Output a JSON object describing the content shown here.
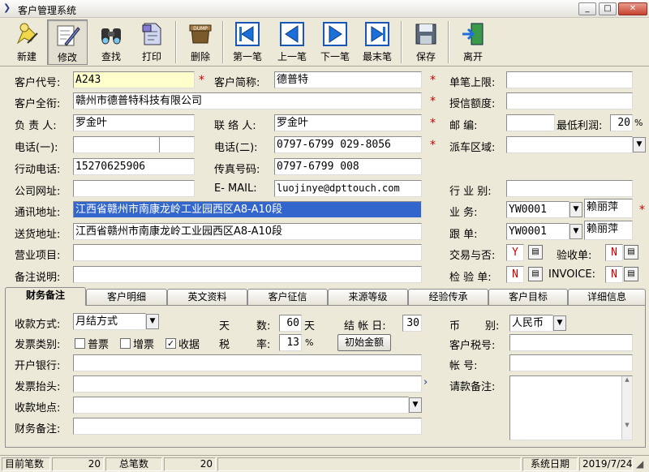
{
  "window": {
    "title": "客户管理系统",
    "min": "_",
    "max": "□",
    "close": "✕"
  },
  "toolbar": [
    {
      "label": "新建",
      "icon": "new-icon"
    },
    {
      "label": "修改",
      "icon": "edit-icon"
    },
    {
      "label": "查找",
      "icon": "find-icon"
    },
    {
      "label": "打印",
      "icon": "print-icon"
    },
    {
      "label": "删除",
      "icon": "delete-icon"
    },
    {
      "label": "第一笔",
      "icon": "first-record-icon"
    },
    {
      "label": "上一笔",
      "icon": "previous-record-icon"
    },
    {
      "label": "下一笔",
      "icon": "next-record-icon"
    },
    {
      "label": "最末笔",
      "icon": "last-record-icon"
    },
    {
      "label": "保存",
      "icon": "save-icon"
    },
    {
      "label": "离开",
      "icon": "exit-icon"
    }
  ],
  "delete_icon_text": "DUMP",
  "form": {
    "customer_code": {
      "label": "客户代号:",
      "value": "A243"
    },
    "short_name": {
      "label": "客户简称:",
      "value": "德普特"
    },
    "single_limit": {
      "label": "单笔上限:",
      "value": ""
    },
    "full_name": {
      "label": "客户全衔:",
      "value": "赣州市德普特科技有限公司"
    },
    "credit_limit": {
      "label": "授信额度:",
      "value": ""
    },
    "owner": {
      "label": "负 责 人:",
      "value": "罗金叶"
    },
    "contact": {
      "label": "联 络 人:",
      "value": "罗金叶"
    },
    "postcode": {
      "label": "邮    编:",
      "value": ""
    },
    "min_profit": {
      "label": "最低利润:",
      "value": "20",
      "unit": "%"
    },
    "phone1": {
      "label": "电话(一):",
      "value": ""
    },
    "phone2": {
      "label": "电话(二):",
      "value": "0797-6799 029-8056"
    },
    "delivery_area": {
      "label": "派车区域:",
      "value": ""
    },
    "mobile": {
      "label": "行动电话:",
      "value": "15270625906"
    },
    "fax": {
      "label": "传真号码:",
      "value": "0797-6799 008"
    },
    "website": {
      "label": "公司网址:",
      "value": ""
    },
    "email": {
      "label": "E- MAIL:",
      "value": "luojinye@dpttouch.com"
    },
    "industry": {
      "label": "行 业 别:",
      "value": ""
    },
    "mail_address": {
      "label": "通讯地址:",
      "value": "江西省赣州市南康龙岭工业园西区A8-A10段"
    },
    "salesman": {
      "label": "业    务:",
      "code": "YW0001",
      "name": "赖丽萍"
    },
    "ship_address": {
      "label": "送货地址:",
      "value": "江西省赣州市南康龙岭工业园西区A8-A10段"
    },
    "follow": {
      "label": "跟    单:",
      "code": "YW0001",
      "name": "赖丽萍"
    },
    "business": {
      "label": "营业项目:",
      "value": ""
    },
    "trade": {
      "label": "交易与否:",
      "value": "Y"
    },
    "acceptance": {
      "label": "验收单:",
      "value": "N"
    },
    "remark": {
      "label": "备注说明:",
      "value": ""
    },
    "inspection": {
      "label": "检 验 单:",
      "value": "N"
    },
    "invoice": {
      "label": "INVOICE:",
      "value": "N"
    }
  },
  "tabs": [
    "财务备注",
    "客户明细",
    "英文资料",
    "客户征信",
    "来源等级",
    "经验传承",
    "客户目标",
    "详细信息"
  ],
  "finance": {
    "pay_method": {
      "label": "收款方式:",
      "value": "月结方式"
    },
    "days": {
      "label_a": "天",
      "label_b": "数:",
      "value": "60",
      "unit": "天"
    },
    "closing_day": {
      "label": "结 帐 日:",
      "value": "30"
    },
    "currency": {
      "label_a": "币",
      "label_b": "别:",
      "value": "人民币"
    },
    "invoice_type": {
      "label": "发票类别:",
      "opt1": "普票",
      "opt2": "增票",
      "opt3": "收据",
      "check": "✓"
    },
    "tax": {
      "label_a": "税",
      "label_b": "率:",
      "value": "13",
      "unit": "%"
    },
    "init_amount": "初始金额",
    "tax_no": {
      "label": "客户税号:",
      "value": ""
    },
    "bank": {
      "label": "开户银行:",
      "value": ""
    },
    "account": {
      "label": "帐    号:",
      "value": ""
    },
    "invoice_title": {
      "label": "发票抬头:",
      "value": ""
    },
    "payment_note": {
      "label": "请款备注:",
      "value": ""
    },
    "collect_place": {
      "label": "收款地点:",
      "value": ""
    },
    "finance_note": {
      "label": "财务备注:",
      "value": ""
    }
  },
  "status": {
    "current_label": "目前笔数",
    "current_value": "20",
    "total_label": "总笔数",
    "total_value": "20",
    "date_label": "系统日期",
    "date_value": "2019/7/24"
  }
}
